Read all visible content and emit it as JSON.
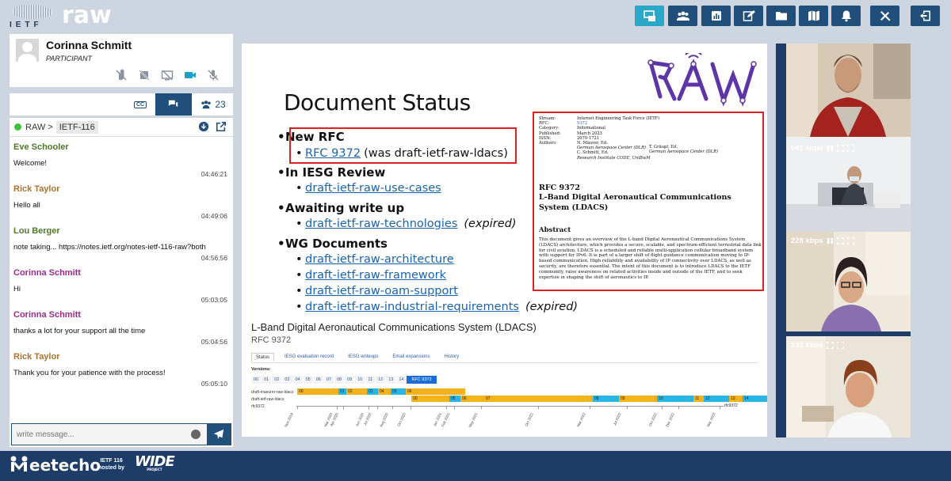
{
  "app": {
    "logo_text": "IETF",
    "room": "raw"
  },
  "toolbar": {
    "buttons": [
      {
        "name": "share-screen",
        "icon": "screen-share-icon",
        "active": true
      },
      {
        "name": "participants",
        "icon": "users-icon",
        "active": false
      },
      {
        "name": "polls",
        "icon": "chart-icon",
        "active": false
      },
      {
        "name": "notes",
        "icon": "edit-icon",
        "active": false
      },
      {
        "name": "files",
        "icon": "folder-icon",
        "active": false
      },
      {
        "name": "map",
        "icon": "map-icon",
        "active": false
      },
      {
        "name": "notifications",
        "icon": "bell-icon",
        "active": false
      },
      {
        "name": "tools",
        "icon": "tools-icon",
        "active": false
      },
      {
        "name": "leave",
        "icon": "exit-icon",
        "active": false
      }
    ],
    "accent": "#2aa7c9",
    "dark": "#1f4f7a"
  },
  "user": {
    "name": "Corinna Schmitt",
    "role": "PARTICIPANT",
    "controls": [
      "hand-off-icon",
      "microphone-off-icon",
      "screen-off-icon",
      "video-icon",
      "audio-off-icon"
    ]
  },
  "tabs": {
    "cc_label": "CC",
    "participants_count": "23"
  },
  "chat": {
    "room_label": "RAW >",
    "room_tag": "IETF-116",
    "placeholder": "write message...",
    "messages": [
      {
        "sender": "Eve Schooler",
        "color": "#4f7a28",
        "text": "Welcome!",
        "time": "04:46:21"
      },
      {
        "sender": "Rick Taylor",
        "color": "#a87330",
        "text": "Hello all",
        "time": "04:49:06"
      },
      {
        "sender": "Lou Berger",
        "color": "#4f7a28",
        "text": "note taking... https://notes.ietf.org/notes-ietf-116-raw?both",
        "time": "04:56:56"
      },
      {
        "sender": "Corinna Schmitt",
        "color": "#9c2a8e",
        "text": "Hi",
        "time": "05:03:05"
      },
      {
        "sender": "Corinna Schmitt",
        "color": "#9c2a8e",
        "text": "thanks a lot for your support all the time",
        "time": "05:04:56"
      },
      {
        "sender": "Rick Taylor",
        "color": "#a87330",
        "text": "Thank you for your patience with the process!",
        "time": "05:05:10"
      }
    ]
  },
  "slide": {
    "title": "Document Status",
    "sections": [
      {
        "heading": "New RFC",
        "items": [
          {
            "link": "RFC 9372",
            "plain": "(was draft-ietf-raw-ldacs)",
            "note": ""
          }
        ]
      },
      {
        "heading": "In IESG Review",
        "items": [
          {
            "link": "draft-ietf-raw-use-cases",
            "plain": "",
            "note": ""
          }
        ]
      },
      {
        "heading": "Awaiting write up",
        "items": [
          {
            "link": "draft-ietf-raw-technologies",
            "plain": "",
            "note": "(expired)"
          }
        ]
      },
      {
        "heading": "WG Documents",
        "items": [
          {
            "link": "draft-ietf-raw-architecture",
            "plain": "",
            "note": ""
          },
          {
            "link": "draft-ietf-raw-framework",
            "plain": "",
            "note": ""
          },
          {
            "link": "draft-ietf-raw-oam-support",
            "plain": "",
            "note": ""
          },
          {
            "link": "draft-ietf-raw-industrial-requirements",
            "plain": "",
            "note": "(expired)"
          }
        ]
      }
    ],
    "rfc": {
      "meta": [
        {
          "k": "Stream:",
          "v": "Internet Engineering Task Force (IETF)"
        },
        {
          "k": "RFC:",
          "v": "9372"
        },
        {
          "k": "Category:",
          "v": "Informational"
        },
        {
          "k": "Published:",
          "v": "March 2023"
        },
        {
          "k": "ISSN:",
          "v": "2070-1721"
        },
        {
          "k": "Authors:",
          "v": "N. Mäurer, Ed."
        }
      ],
      "authors_extra": [
        "German Aerospace Center (DLR)",
        "C. Schmitt, Ed.",
        "Research Institute CODE, UniBwM"
      ],
      "author2": [
        "T. Gräupl, Ed.",
        "German Aerospace Center (DLR)"
      ],
      "number": "RFC 9372",
      "title": "L-Band Digital Aeronautical Communications System (LDACS)",
      "abstract_heading": "Abstract",
      "abstract": "This document gives an overview of the L-band Digital Aeronautical Communications System (LDACS) architecture, which provides a secure, scalable, and spectrum-efficient terrestrial data link for civil aviation. LDACS is a scheduled and reliable multi-application cellular broadband system with support for IPv6. It is part of a larger shift of flight guidance communication moving to IP-based communication. High reliability and availability of IP connectivity over LDACS, as well as security, are therefore essential. The intent of this document is to introduce LDACS to the IETF community, raise awareness on related activities inside and outside of the IETF, and to seek expertise in shaping the shift of aeronautics to IP."
    },
    "datatracker": {
      "title": "L-Band Digital Aeronautical Communications System (LDACS)",
      "subtitle": "RFC 9372",
      "tabs": [
        "Status",
        "IESG evaluation record",
        "IESG writeups",
        "Email expansions",
        "History"
      ],
      "versions_label": "Versions:",
      "versions": [
        "00",
        "01",
        "02",
        "03",
        "04",
        "05",
        "06",
        "07",
        "08",
        "09",
        "10",
        "11",
        "12",
        "13",
        "14",
        "RFC 9372"
      ],
      "rows": [
        "draft-maeurer-raw-ldacs",
        "draft-ietf-raw-ldacs",
        "rfc9372"
      ],
      "row1_segments": [
        {
          "label": "00",
          "color": "#f5b21a"
        },
        {
          "label": "01",
          "color": "#29b6e6"
        },
        {
          "label": "02",
          "color": "#f5b21a"
        },
        {
          "label": "03",
          "color": "#29b6e6"
        },
        {
          "label": "04",
          "color": "#f5b21a"
        },
        {
          "label": "05",
          "color": "#29b6e6"
        },
        {
          "label": "06",
          "color": "#f5b21a"
        }
      ],
      "row2_segments": [
        {
          "label": "00",
          "color": "#f5b21a"
        },
        {
          "label": "05",
          "color": "#29b6e6"
        },
        {
          "label": "06",
          "color": "#f5b21a"
        },
        {
          "label": "07",
          "color": "#f5b21a"
        },
        {
          "label": "08",
          "color": "#29b6e6"
        },
        {
          "label": "09",
          "color": "#f5b21a"
        },
        {
          "label": "10",
          "color": "#29b6e6"
        },
        {
          "label": "11",
          "color": "#f5b21a"
        },
        {
          "label": "12",
          "color": "#29b6e6"
        },
        {
          "label": "13",
          "color": "#f5b21a"
        },
        {
          "label": "14",
          "color": "#29b6e6"
        }
      ],
      "row3_label": "rfc9372",
      "dates": [
        "Nov 2019",
        "Mar 2020",
        "Apr 2020",
        "Jun 2020",
        "Jul 2020",
        "Aug 2020",
        "Oct 2020",
        "Jan 2021",
        "Feb 2021",
        "May 2021",
        "Oct 2021",
        "Mar 2022",
        "Jul 2022",
        "Oct 2022",
        "Dec 2022",
        "Mar 2023"
      ]
    }
  },
  "videos": [
    {
      "name": "participant-video-1",
      "kbps": "541 kbps"
    },
    {
      "name": "participant-video-2",
      "kbps": "228 kbps"
    },
    {
      "name": "participant-video-3",
      "kbps": "233 kbps"
    }
  ],
  "footer": {
    "brand": "eetecho",
    "hosted_line1": "IETF 116",
    "hosted_line2": "hosted by",
    "sponsor": "WIDE",
    "sponsor_sub": "PROJECT"
  }
}
